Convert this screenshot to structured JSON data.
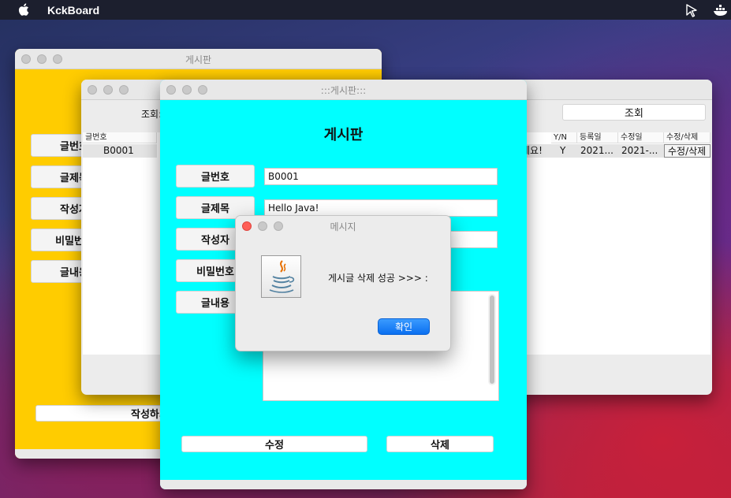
{
  "menubar": {
    "app_name": "KckBoard",
    "icons": [
      "apple-icon",
      "cursor-icon",
      "docker-icon"
    ]
  },
  "yellow_window": {
    "title": "게시판",
    "labels": [
      "글번호",
      "글제목",
      "작성자",
      "비밀번호",
      "글내용"
    ],
    "write_button": "작성하기"
  },
  "list_window": {
    "search_label": "조회:",
    "search_button": "조회",
    "columns": [
      "글번호",
      "Y/N",
      "등록일",
      "수정일",
      "수정/삭제"
    ],
    "row": {
      "no": "B0001",
      "partial_title": "세요!",
      "yn": "Y",
      "reg_date": "2021...",
      "mod_date": "2021-...",
      "action": "수정/삭제"
    }
  },
  "cyan_window": {
    "title": ":::게시판:::",
    "heading": "게시판",
    "fields": [
      {
        "label": "글번호",
        "value": "B0001"
      },
      {
        "label": "글제목",
        "value": "Hello Java!"
      },
      {
        "label": "작성자",
        "value": ""
      },
      {
        "label": "비밀번호",
        "value": ""
      },
      {
        "label": "글내용",
        "value": ""
      }
    ],
    "edit_button": "수정",
    "delete_button": "삭제"
  },
  "dialog": {
    "title": "메시지",
    "message": "게시글 삭제 성공 >>> :",
    "ok_button": "확인",
    "icon": "java-icon"
  },
  "colors": {
    "yellow": "#ffcc00",
    "cyan": "#00ffff",
    "accent_button": "#0a6ff0"
  }
}
